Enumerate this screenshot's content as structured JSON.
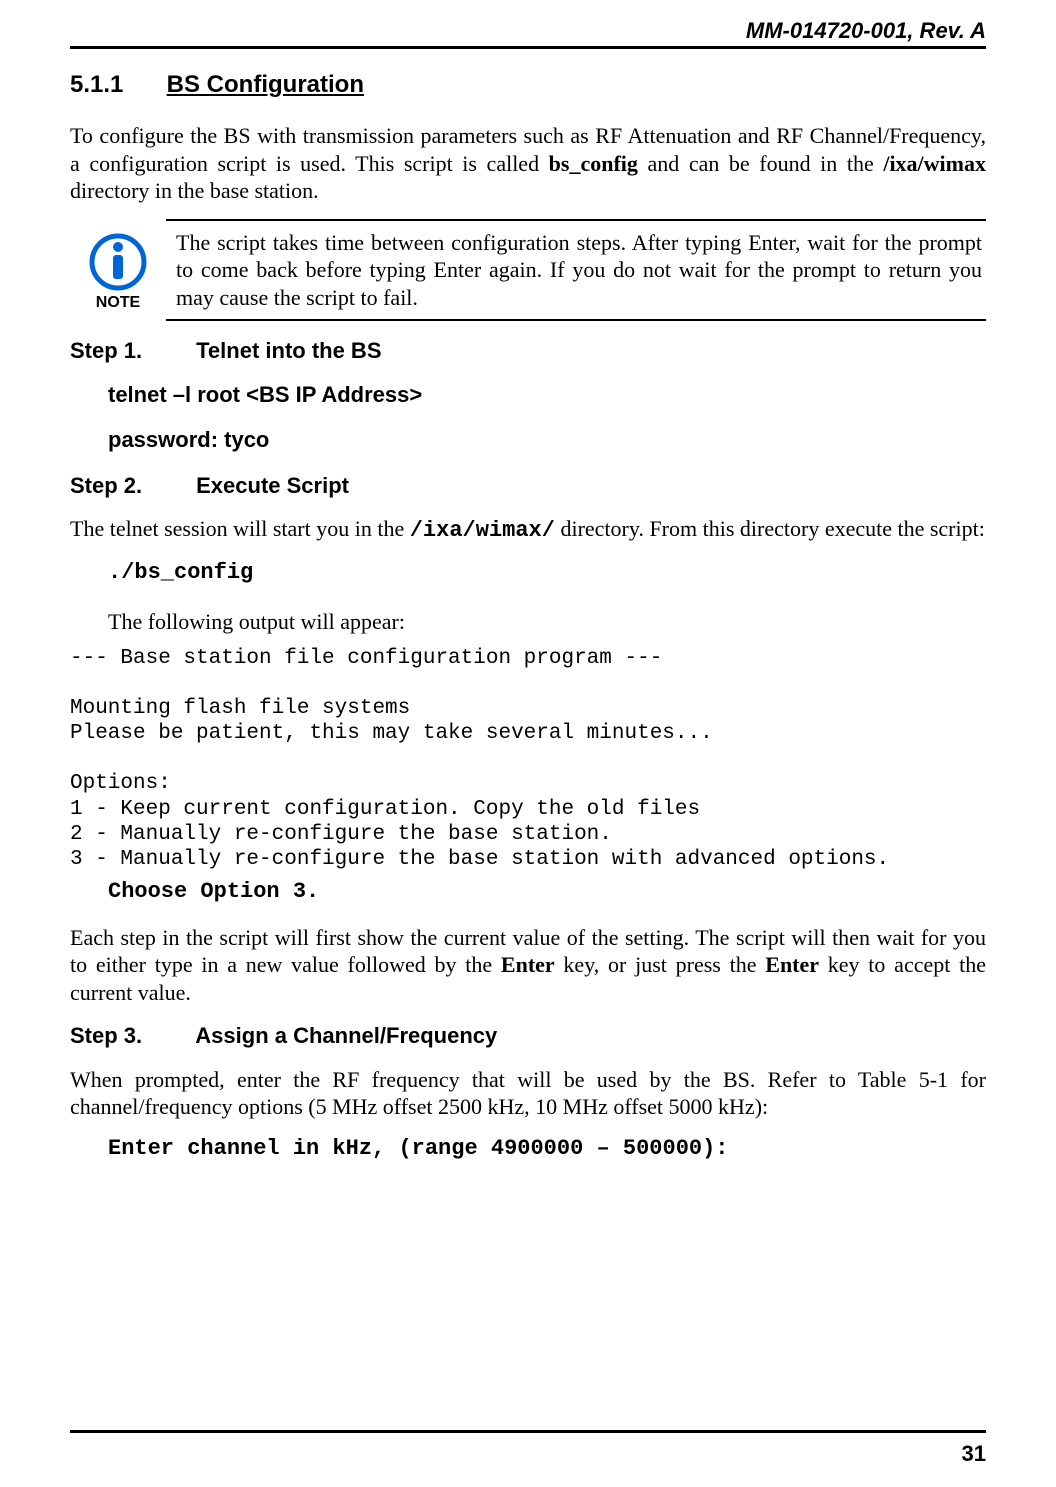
{
  "header": {
    "doc_id": "MM-014720-001, Rev. A"
  },
  "footer": {
    "page_number": "31"
  },
  "section": {
    "number": "5.1.1",
    "title": "BS Configuration"
  },
  "intro": {
    "p1a": "To configure the BS with transmission parameters such as RF Attenuation and RF Channel/Frequency, a configuration script is used.  This script is called ",
    "p1_bold1": "bs_config",
    "p1b": " and can be found in the ",
    "p1_bold2": "/ixa/wimax",
    "p1c": " directory in the base station."
  },
  "note": {
    "label": "NOTE",
    "text": "The script takes time between configuration steps.  After typing Enter, wait for the prompt to come back before typing Enter again.  If you do not wait for the prompt to return you may cause the script to fail."
  },
  "step1": {
    "label": "Step 1.",
    "title": "Telnet into the BS",
    "line1": "telnet –l root <BS IP Address>",
    "line2": "password: tyco"
  },
  "step2": {
    "label": "Step 2.",
    "title": "Execute Script",
    "p1a": "The telnet session will start you in the ",
    "p1_mono": "/ixa/wimax/",
    "p1b": " directory.  From this directory execute the script:",
    "cmd": "./bs_config",
    "p2": "The following output will appear:",
    "output": "--- Base station file configuration program ---\n\nMounting flash file systems\nPlease be patient, this may take several minutes...\n\nOptions:\n1 - Keep current configuration. Copy the old files\n2 - Manually re-configure the base station.\n3 - Manually re-configure the base station with advanced options.",
    "choose": "Choose Option 3.",
    "p3a": "Each step in the script will first show the current value of the setting.  The script will then wait for you to either type in a new value followed by the ",
    "p3_bold1": "Enter",
    "p3b": " key, or just press the ",
    "p3_bold2": "Enter",
    "p3c": " key to accept the current value."
  },
  "step3": {
    "label": "Step 3.",
    "title": "Assign a Channel/Frequency",
    "p1": "When prompted, enter the RF frequency that will be used by the BS.  Refer to Table 5-1 for channel/frequency options (5 MHz offset 2500 kHz, 10 MHz offset 5000 kHz):",
    "cmd": "Enter channel in kHz, (range 4900000 – 500000):"
  }
}
